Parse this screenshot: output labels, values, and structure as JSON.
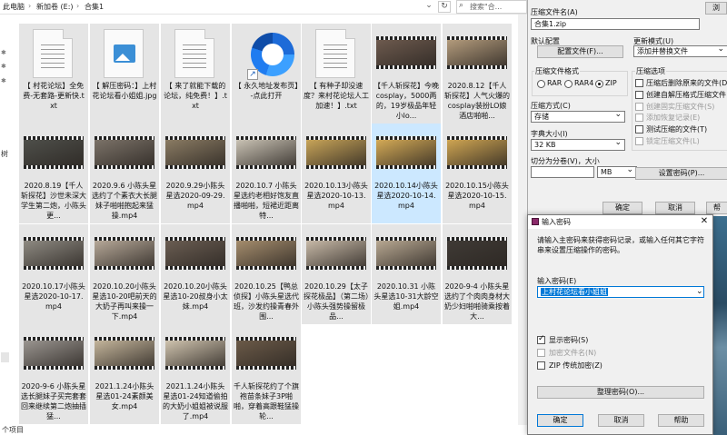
{
  "explorer": {
    "breadcrumbs": [
      "此电脑",
      "新加卷 (E:)",
      "合集1"
    ],
    "search_placeholder": "搜索\"合...",
    "status": "个项目",
    "files": [
      {
        "name": "【 村花论坛】全免费-无套路-更新快.txt",
        "kind": "text"
      },
      {
        "name": "【 解压密码：】上村花论坛看小姐姐.jpg",
        "kind": "image"
      },
      {
        "name": "【 来了就能下载的论坛，纯免费！】.txt",
        "kind": "text"
      },
      {
        "name": "【 永久地址发布页】-点此打开",
        "kind": "url"
      },
      {
        "name": "【 有种子却没速度？来村花论坛人工加速！】.txt",
        "kind": "text"
      },
      {
        "name": "【千人斩探花】今晚cosplay，5000两的，19岁极品年轻小lo...",
        "kind": "video",
        "frame": "#6d5a4e"
      },
      {
        "name": "2020.8.12【千人斩探花】人气火爆的cosplay装扮LO娘酒店啪啪...",
        "kind": "video",
        "frame": "#b39b7c"
      },
      {
        "name": "2020.8.19【千人斩探花】沙世未深大学生第二炮，小陈头更...",
        "kind": "video",
        "frame": "#4e4f4a"
      },
      {
        "name": "2020.9.6 小陈头星选约了个素衣大长腿妹子啪啪抱起来猛操.mp4",
        "kind": "video",
        "frame": "#7b7268"
      },
      {
        "name": "2020.9.29小陈头星选2020-09-29.mp4",
        "kind": "video",
        "frame": "#8a7b63"
      },
      {
        "name": "2020.10.7 小陈头星选约老相好饱友直播啪啪，短裙近距离特...",
        "kind": "video",
        "frame": "#c9c2b4"
      },
      {
        "name": "2020.10.13小陈头星选2020-10-13.mp4",
        "kind": "video",
        "frame": "#c8a458"
      },
      {
        "name": "2020.10.14小陈头星选2020-10-14.mp4",
        "kind": "video",
        "frame": "#d4aa56",
        "selected": true
      },
      {
        "name": "2020.10.15小陈头星选2020-10-15.mp4",
        "kind": "video",
        "frame": "#cfa552"
      },
      {
        "name": "2020.10.17小陈头星选2020-10-17.mp4",
        "kind": "video",
        "frame": "#8e8a82"
      },
      {
        "name": "2020.10.20小陈头星选10-20吧前天的大奶子再叫来操一下.mp4",
        "kind": "video",
        "frame": "#b6a898"
      },
      {
        "name": "2020.10.20小陈头星选10-20叔身小太妹.mp4",
        "kind": "video",
        "frame": "#6a5d52"
      },
      {
        "name": "2020.10.25【鸭总侦探】小陈头星选代班，沙发约操青春外围...",
        "kind": "video",
        "frame": "#a58d6d"
      },
      {
        "name": "2020.10.29【太子探花极品】（第二场）小陈头强势操留极品...",
        "kind": "video",
        "frame": "#c7b9a7"
      },
      {
        "name": "2020.10.31 小陈头星选10-31大龄空姐.mp4",
        "kind": "video",
        "frame": "#b8a892"
      },
      {
        "name": "2020-9-4 小陈头星选约了个肉肉身材大奶少妇啪啪骑乘按着大...",
        "kind": "video",
        "frame": "#3f3a35"
      },
      {
        "name": "2020-9-6 小陈头星选长腿妹子买完套套回来继续第二炮抽插猛...",
        "kind": "video",
        "frame": "#9a9590"
      },
      {
        "name": "2021.1.24小陈头星选01-24素颜美女.mp4",
        "kind": "video",
        "frame": "#c4b59b"
      },
      {
        "name": "2021.1.24小陈头星选01-24知道偷拍的大奶小姐姐被说服了.mp4",
        "kind": "video",
        "frame": "#cfc3ae"
      },
      {
        "name": "千人斩探花约了个旗袍苗条妹子3P啪啪，穿着高跟鞋猛操轮...",
        "kind": "video",
        "frame": "#6b5a48"
      }
    ]
  },
  "archive_dialog": {
    "archive_name_label": "压缩文件名(A)",
    "archive_name_value": "合集1.zip",
    "browse_label": "浏",
    "profile_label": "默认配置",
    "profile_button": "配置文件(F)...",
    "update_mode_label": "更新模式(U)",
    "update_mode_value": "添加并替换文件",
    "format_group_label": "压缩文件格式",
    "format_options": [
      "RAR",
      "RAR4",
      "ZIP"
    ],
    "format_selected": "ZIP",
    "method_label": "压缩方式(C)",
    "method_value": "存储",
    "dict_label": "字典大小(I)",
    "dict_value": "32 KB",
    "split_label": "切分为分卷(V)，大小",
    "split_unit": "MB",
    "options_group_label": "压缩选项",
    "options": [
      {
        "label": "压缩后删除原来的文件(D)",
        "checked": false,
        "enabled": true
      },
      {
        "label": "创建自解压格式压缩文件",
        "checked": false,
        "enabled": true
      },
      {
        "label": "创建固实压缩文件(S)",
        "checked": false,
        "enabled": false
      },
      {
        "label": "添加恢复记录(E)",
        "checked": false,
        "enabled": false
      },
      {
        "label": "测试压缩的文件(T)",
        "checked": false,
        "enabled": true
      },
      {
        "label": "锁定压缩文件(L)",
        "checked": false,
        "enabled": false
      }
    ],
    "set_password_button": "设置密码(P)...",
    "ok": "确定",
    "cancel": "取消",
    "help": "帮"
  },
  "password_dialog": {
    "title": "输入密码",
    "close": "✕",
    "description": "请输入主密码来获得密码记录，或输入任何其它字符串来设置压缩操作的密码。",
    "input_label": "输入密码(E)",
    "input_value": "上村花论坛看小姐姐",
    "show_password": {
      "label": "显示密码(S)",
      "checked": true
    },
    "encrypt_names": {
      "label": "加密文件名(N)",
      "checked": false,
      "enabled": false
    },
    "zip_legacy": {
      "label": "ZIP 传统加密(Z)",
      "checked": false
    },
    "organize_button": "整理密码(O)...",
    "ok": "确定",
    "cancel": "取消",
    "help": "帮助"
  }
}
